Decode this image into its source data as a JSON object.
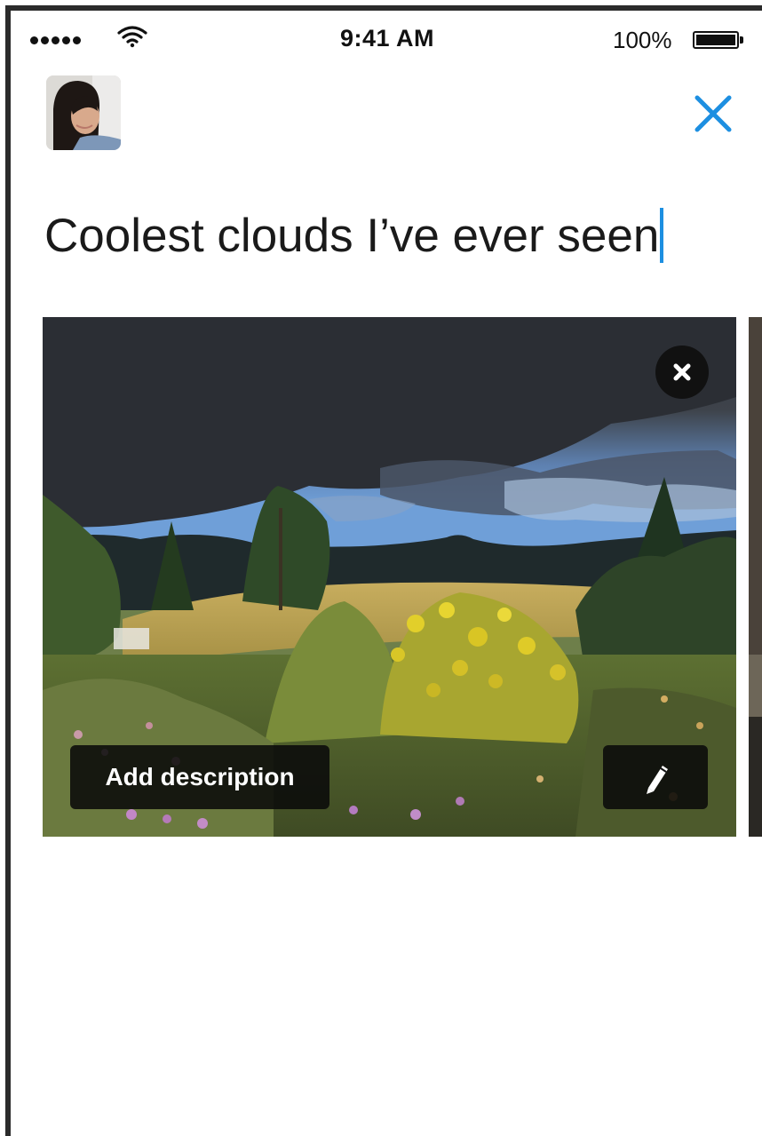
{
  "status_bar": {
    "time": "9:41 AM",
    "battery_percent": "100%",
    "signal_icon": "cellular-signal-icon",
    "wifi_icon": "wifi-icon",
    "battery_icon": "battery-full-icon"
  },
  "header": {
    "avatar": "user-avatar",
    "close_icon": "close-icon",
    "accent_color": "#1d8fe1"
  },
  "composer": {
    "text": "Coolest clouds I’ve ever seen"
  },
  "media": {
    "photo": "landscape-photo-storm-clouds-meadow",
    "remove_icon": "remove-x-icon",
    "add_description_label": "Add description",
    "edit_icon": "pencil-icon"
  }
}
